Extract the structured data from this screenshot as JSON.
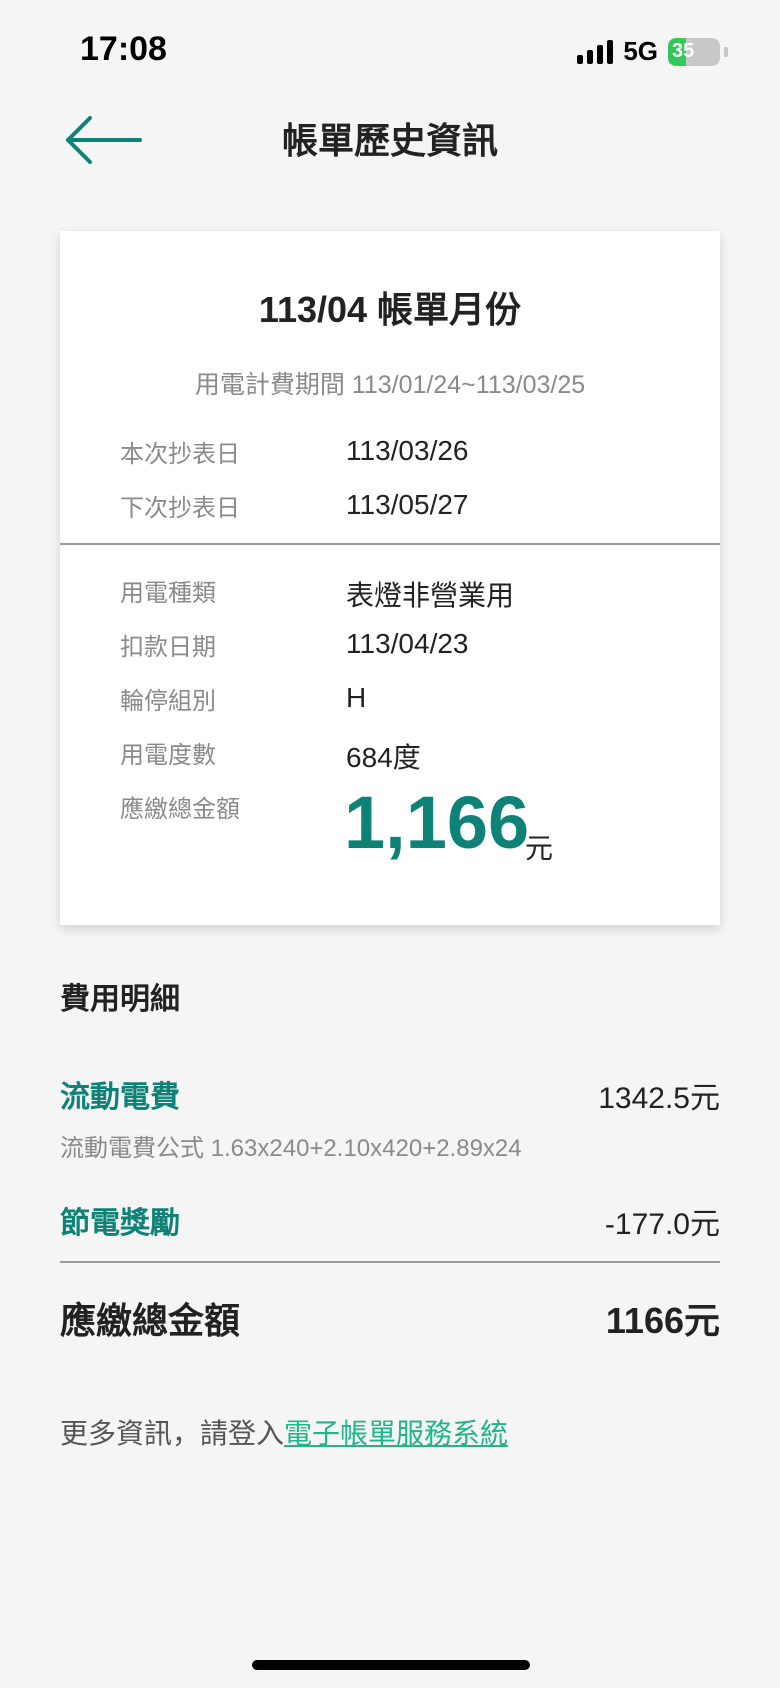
{
  "status_bar": {
    "time": "17:08",
    "network": "5G",
    "battery": "35"
  },
  "header": {
    "title": "帳單歷史資訊",
    "accent_color": "#0e8276"
  },
  "bill": {
    "month_title": "113/04 帳單月份",
    "period": "用電計費期間 113/01/24~113/03/25",
    "rows_top": [
      {
        "label": "本次抄表日",
        "value": "113/03/26"
      },
      {
        "label": "下次抄表日",
        "value": "113/05/27"
      }
    ],
    "rows_bottom": [
      {
        "label": "用電種類",
        "value": "表燈非營業用"
      },
      {
        "label": "扣款日期",
        "value": "113/04/23"
      },
      {
        "label": "輪停組別",
        "value": "H"
      },
      {
        "label": "用電度數",
        "value": "684度"
      }
    ],
    "total_label": "應繳總金額",
    "total_value": "1,166",
    "total_unit": "元"
  },
  "fees": {
    "section_title": "費用明細",
    "items": [
      {
        "name": "流動電費",
        "amount": "1342.5元",
        "formula": "流動電費公式 1.63x240+2.10x420+2.89x24"
      },
      {
        "name": "節電獎勵",
        "amount": "-177.0元"
      }
    ],
    "total_label": "應繳總金額",
    "total_value": "1166元"
  },
  "footer": {
    "prefix": "更多資訊，請登入",
    "link": "電子帳單服務系統"
  }
}
